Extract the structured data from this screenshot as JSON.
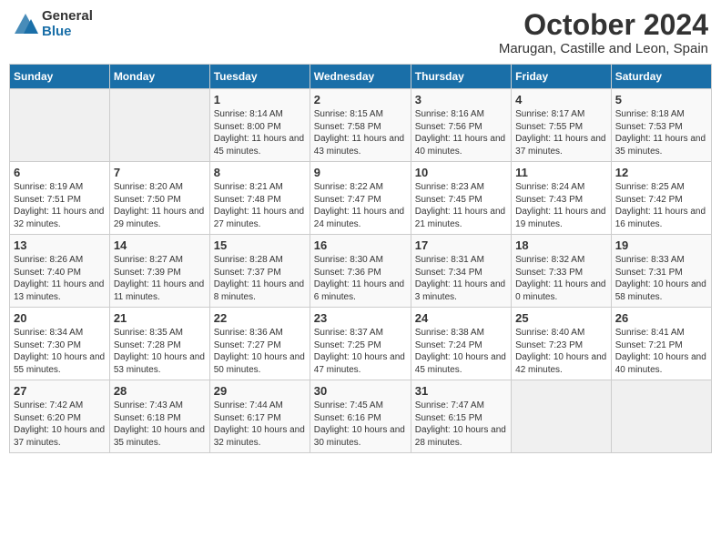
{
  "header": {
    "logo_general": "General",
    "logo_blue": "Blue",
    "month_title": "October 2024",
    "location": "Marugan, Castille and Leon, Spain"
  },
  "days_of_week": [
    "Sunday",
    "Monday",
    "Tuesday",
    "Wednesday",
    "Thursday",
    "Friday",
    "Saturday"
  ],
  "weeks": [
    [
      {
        "day": "",
        "info": ""
      },
      {
        "day": "",
        "info": ""
      },
      {
        "day": "1",
        "info": "Sunrise: 8:14 AM\nSunset: 8:00 PM\nDaylight: 11 hours and 45 minutes."
      },
      {
        "day": "2",
        "info": "Sunrise: 8:15 AM\nSunset: 7:58 PM\nDaylight: 11 hours and 43 minutes."
      },
      {
        "day": "3",
        "info": "Sunrise: 8:16 AM\nSunset: 7:56 PM\nDaylight: 11 hours and 40 minutes."
      },
      {
        "day": "4",
        "info": "Sunrise: 8:17 AM\nSunset: 7:55 PM\nDaylight: 11 hours and 37 minutes."
      },
      {
        "day": "5",
        "info": "Sunrise: 8:18 AM\nSunset: 7:53 PM\nDaylight: 11 hours and 35 minutes."
      }
    ],
    [
      {
        "day": "6",
        "info": "Sunrise: 8:19 AM\nSunset: 7:51 PM\nDaylight: 11 hours and 32 minutes."
      },
      {
        "day": "7",
        "info": "Sunrise: 8:20 AM\nSunset: 7:50 PM\nDaylight: 11 hours and 29 minutes."
      },
      {
        "day": "8",
        "info": "Sunrise: 8:21 AM\nSunset: 7:48 PM\nDaylight: 11 hours and 27 minutes."
      },
      {
        "day": "9",
        "info": "Sunrise: 8:22 AM\nSunset: 7:47 PM\nDaylight: 11 hours and 24 minutes."
      },
      {
        "day": "10",
        "info": "Sunrise: 8:23 AM\nSunset: 7:45 PM\nDaylight: 11 hours and 21 minutes."
      },
      {
        "day": "11",
        "info": "Sunrise: 8:24 AM\nSunset: 7:43 PM\nDaylight: 11 hours and 19 minutes."
      },
      {
        "day": "12",
        "info": "Sunrise: 8:25 AM\nSunset: 7:42 PM\nDaylight: 11 hours and 16 minutes."
      }
    ],
    [
      {
        "day": "13",
        "info": "Sunrise: 8:26 AM\nSunset: 7:40 PM\nDaylight: 11 hours and 13 minutes."
      },
      {
        "day": "14",
        "info": "Sunrise: 8:27 AM\nSunset: 7:39 PM\nDaylight: 11 hours and 11 minutes."
      },
      {
        "day": "15",
        "info": "Sunrise: 8:28 AM\nSunset: 7:37 PM\nDaylight: 11 hours and 8 minutes."
      },
      {
        "day": "16",
        "info": "Sunrise: 8:30 AM\nSunset: 7:36 PM\nDaylight: 11 hours and 6 minutes."
      },
      {
        "day": "17",
        "info": "Sunrise: 8:31 AM\nSunset: 7:34 PM\nDaylight: 11 hours and 3 minutes."
      },
      {
        "day": "18",
        "info": "Sunrise: 8:32 AM\nSunset: 7:33 PM\nDaylight: 11 hours and 0 minutes."
      },
      {
        "day": "19",
        "info": "Sunrise: 8:33 AM\nSunset: 7:31 PM\nDaylight: 10 hours and 58 minutes."
      }
    ],
    [
      {
        "day": "20",
        "info": "Sunrise: 8:34 AM\nSunset: 7:30 PM\nDaylight: 10 hours and 55 minutes."
      },
      {
        "day": "21",
        "info": "Sunrise: 8:35 AM\nSunset: 7:28 PM\nDaylight: 10 hours and 53 minutes."
      },
      {
        "day": "22",
        "info": "Sunrise: 8:36 AM\nSunset: 7:27 PM\nDaylight: 10 hours and 50 minutes."
      },
      {
        "day": "23",
        "info": "Sunrise: 8:37 AM\nSunset: 7:25 PM\nDaylight: 10 hours and 47 minutes."
      },
      {
        "day": "24",
        "info": "Sunrise: 8:38 AM\nSunset: 7:24 PM\nDaylight: 10 hours and 45 minutes."
      },
      {
        "day": "25",
        "info": "Sunrise: 8:40 AM\nSunset: 7:23 PM\nDaylight: 10 hours and 42 minutes."
      },
      {
        "day": "26",
        "info": "Sunrise: 8:41 AM\nSunset: 7:21 PM\nDaylight: 10 hours and 40 minutes."
      }
    ],
    [
      {
        "day": "27",
        "info": "Sunrise: 7:42 AM\nSunset: 6:20 PM\nDaylight: 10 hours and 37 minutes."
      },
      {
        "day": "28",
        "info": "Sunrise: 7:43 AM\nSunset: 6:18 PM\nDaylight: 10 hours and 35 minutes."
      },
      {
        "day": "29",
        "info": "Sunrise: 7:44 AM\nSunset: 6:17 PM\nDaylight: 10 hours and 32 minutes."
      },
      {
        "day": "30",
        "info": "Sunrise: 7:45 AM\nSunset: 6:16 PM\nDaylight: 10 hours and 30 minutes."
      },
      {
        "day": "31",
        "info": "Sunrise: 7:47 AM\nSunset: 6:15 PM\nDaylight: 10 hours and 28 minutes."
      },
      {
        "day": "",
        "info": ""
      },
      {
        "day": "",
        "info": ""
      }
    ]
  ]
}
